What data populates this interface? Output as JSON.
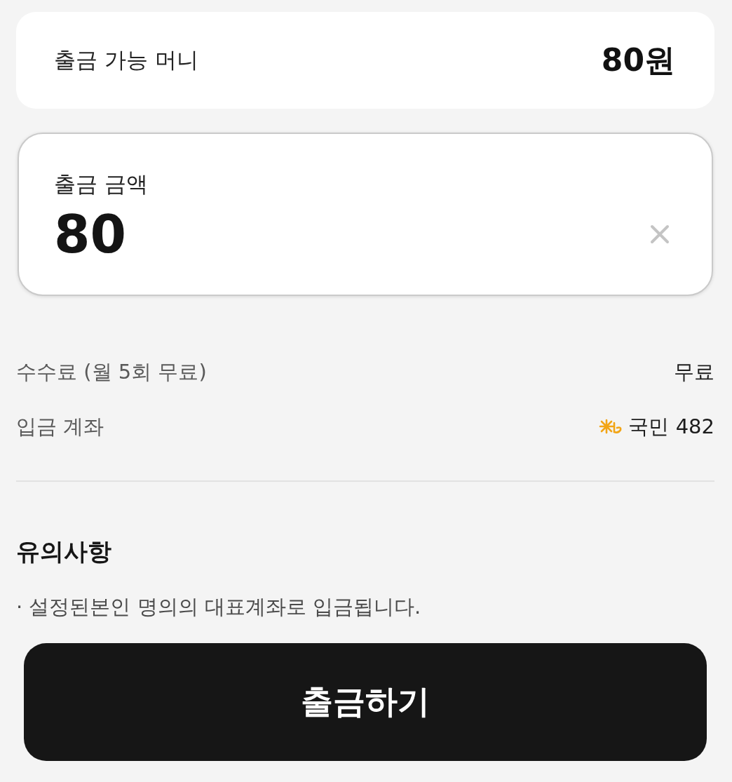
{
  "balance": {
    "label": "출금 가능 머니",
    "value": "80원"
  },
  "amount": {
    "label": "출금 금액",
    "value": "80"
  },
  "details": [
    {
      "kind": "text",
      "label": "수수료 (월 5회 무료)",
      "value": "무료"
    },
    {
      "kind": "account",
      "label": "입금 계좌",
      "value": "국민 482"
    }
  ],
  "notice": {
    "title": "유의사항",
    "items": [
      "· 설정된본인 명의의 대표계좌로 입금됩니다."
    ]
  },
  "submit_button": "출금하기"
}
